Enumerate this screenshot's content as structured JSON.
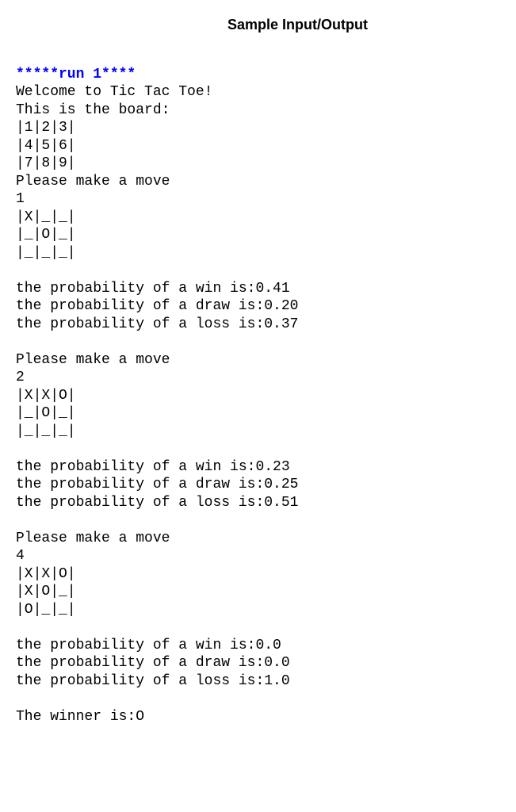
{
  "heading": "Sample Input/Output",
  "run_header": "*****run 1****",
  "intro": "Welcome to Tic Tac Toe!\nThis is the board:\n",
  "initial_board": "|1|2|3|\n|4|5|6|\n|7|8|9|",
  "move1": {
    "prompt": "Please make a move",
    "input": "1",
    "board": "|X|_|_|\n|_|O|_|\n|_|_|_|",
    "prob_win": "the probability of a win is:0.41",
    "prob_draw": "the probability of a draw is:0.20",
    "prob_loss": "the probability of a loss is:0.37"
  },
  "move2": {
    "prompt": "Please make a move",
    "input": "2",
    "board": "|X|X|O|\n|_|O|_|\n|_|_|_|",
    "prob_win": "the probability of a win is:0.23",
    "prob_draw": "the probability of a draw is:0.25",
    "prob_loss": "the probability of a loss is:0.51"
  },
  "move3": {
    "prompt": "Please make a move",
    "input": "4",
    "board": "|X|X|O|\n|X|O|_|\n|O|_|_|",
    "prob_win": "the probability of a win is:0.0",
    "prob_draw": "the probability of a draw is:0.0",
    "prob_loss": "the probability of a loss is:1.0"
  },
  "winner": "The winner is:O"
}
